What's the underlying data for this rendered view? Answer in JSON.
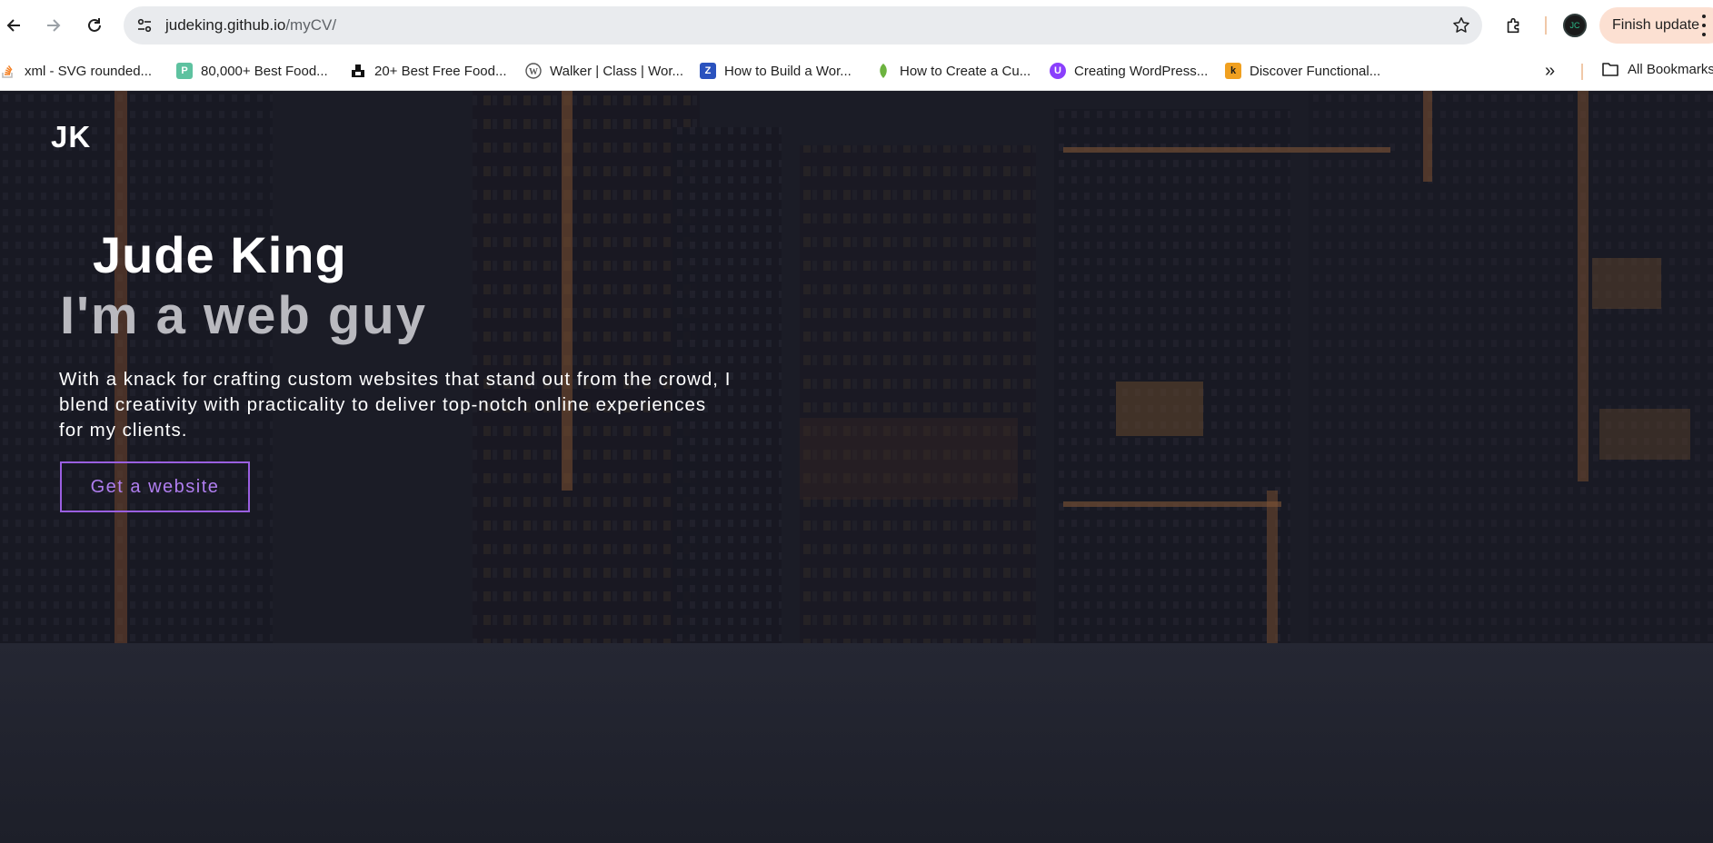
{
  "browser": {
    "url_host": "judeking.github.io",
    "url_path": "/myCV/",
    "finish_update_label": "Finish update",
    "profile_initials": "JC",
    "bookmarks": [
      {
        "label": "xml - SVG rounded...",
        "icon": "stackoverflow-icon"
      },
      {
        "label": "80,000+ Best Food...",
        "icon": "freepik-icon"
      },
      {
        "label": "20+ Best Free Food...",
        "icon": "site-icon"
      },
      {
        "label": "Walker | Class | Wor...",
        "icon": "wordpress-icon"
      },
      {
        "label": "How to Build a Wor...",
        "icon": "site-icon"
      },
      {
        "label": "How to Create a Cu...",
        "icon": "leaf-icon"
      },
      {
        "label": "Creating WordPress...",
        "icon": "site-icon"
      },
      {
        "label": "Discover Functional...",
        "icon": "k-icon"
      }
    ],
    "all_bookmarks_label": "All Bookmarks"
  },
  "page": {
    "logo": "JK",
    "name": "Jude King",
    "tagline": "I'm a web guy",
    "description": "With a knack for crafting custom websites that stand out from the crowd, I blend creativity with practicality to deliver top-notch online experiences for my clients.",
    "cta_label": "Get a website"
  },
  "colors": {
    "accent": "#9a5fe0",
    "hero_text": "#ffffff",
    "tagline": "#b9b9bf",
    "background": "#1c1e27"
  }
}
